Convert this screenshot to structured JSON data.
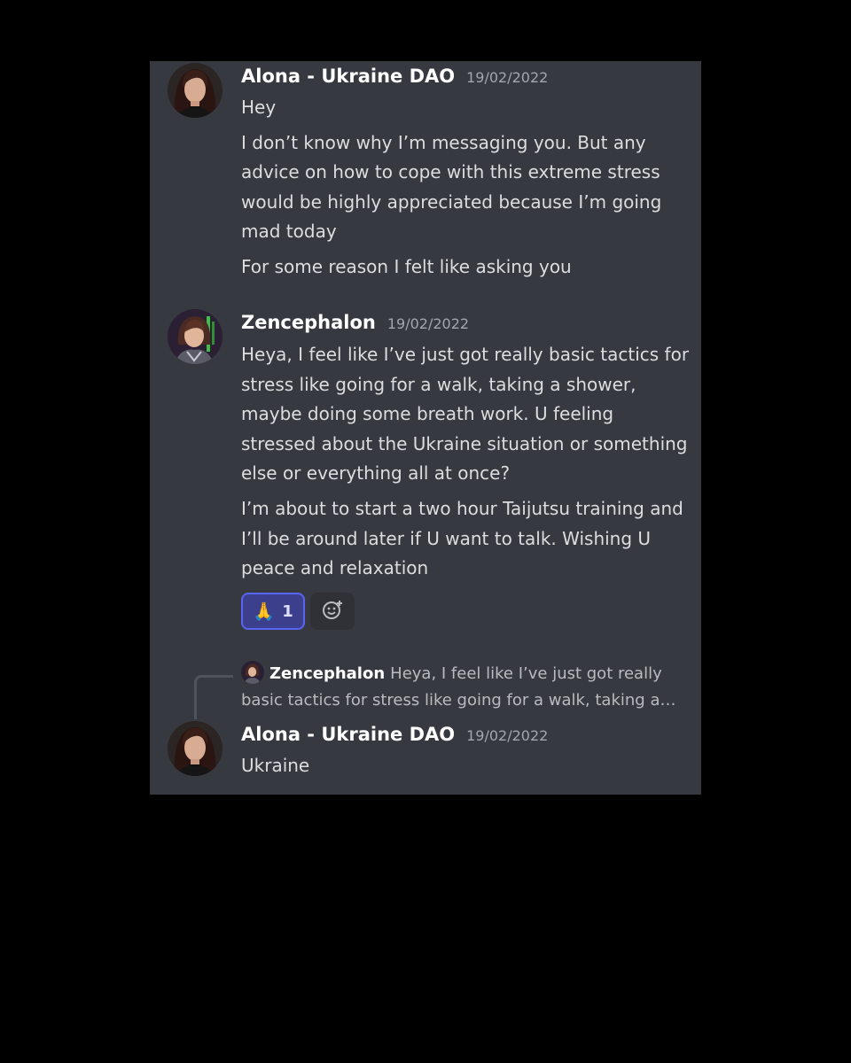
{
  "messages": [
    {
      "username": "Alona - Ukraine DAO",
      "timestamp": "19/02/2022",
      "avatar_icon": "user-avatar-alona",
      "lines": [
        "Hey",
        "I don’t know why I’m messaging you. But any advice on how to cope with this extreme stress would be highly appreciated because I’m going mad today",
        "For some reason I felt like asking you"
      ]
    },
    {
      "username": "Zencephalon",
      "timestamp": "19/02/2022",
      "avatar_icon": "user-avatar-zencephalon",
      "lines": [
        "Heya, I feel like I’ve just got really basic tactics for stress like going for a walk, taking a shower, maybe doing some breath work. U feeling stressed about the Ukraine situation or something else or everything all at once?",
        "I’m about to start a two hour Taijutsu training and I’ll be around later if U want to talk. Wishing U peace and relaxation"
      ],
      "reactions": [
        {
          "emoji": "🙏",
          "emoji_icon": "folded-hands-icon",
          "count": "1"
        }
      ],
      "add_reaction_icon": "add-reaction-icon"
    },
    {
      "username": "Alona - Ukraine DAO",
      "timestamp": "19/02/2022",
      "avatar_icon": "user-avatar-alona",
      "reply_to": {
        "username": "Zencephalon",
        "text_line1": "Heya, I feel like I’ve just got really",
        "text_line2": "basic tactics for stress like going for a walk, taking a…"
      },
      "lines": [
        "Ukraine"
      ]
    }
  ],
  "colors": {
    "background": "#000000",
    "panel": "#36393f",
    "username": "#ffffff",
    "timestamp": "#a3a6aa",
    "message_text": "#dcddde",
    "reaction_border": "#5865f2",
    "reaction_bg": "#3b3f8c"
  }
}
